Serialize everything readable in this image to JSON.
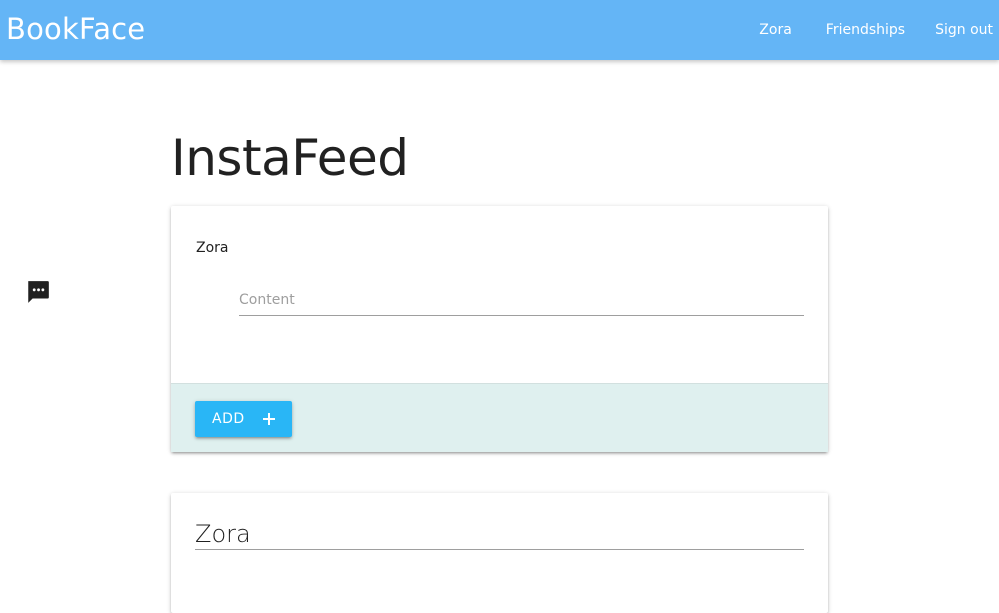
{
  "navbar": {
    "brand": "BookFace",
    "links": [
      {
        "label": "Zora"
      },
      {
        "label": "Friendships"
      },
      {
        "label": "Sign out"
      }
    ],
    "color": "#64b5f6"
  },
  "page": {
    "title": "InstaFeed"
  },
  "compose": {
    "author": "Zora",
    "content_value": "",
    "content_placeholder": "Content",
    "add_label": "ADD",
    "add_icon": "plus-icon",
    "message_icon": "chat-bubble-icon",
    "action_background": "#dff0ef",
    "button_color": "#29b6f6"
  },
  "posts": [
    {
      "author": "Zora"
    }
  ]
}
